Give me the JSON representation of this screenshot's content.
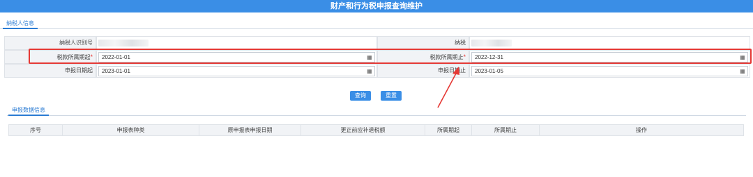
{
  "page_title": "财产和行为税申报查询维护",
  "tabs": {
    "taxpayer_info": "纳税人信息",
    "declaration_data": "申报数据信息"
  },
  "form": {
    "taxpayer_id_label": "纳税人识别号",
    "taxpayer_name_label": "纳税",
    "tax_period_start_label": "税款所属期起",
    "tax_period_start_value": "2022-01-01",
    "tax_period_end_label": "税款所属期止",
    "tax_period_end_value": "2022-12-31",
    "declare_date_start_label": "申报日期起",
    "declare_date_start_value": "2023-01-01",
    "declare_date_end_label": "申报日期止",
    "declare_date_end_value": "2023-01-05",
    "required_mark": "*",
    "calendar_icon_glyph": "▦"
  },
  "buttons": {
    "query": "查询",
    "reset": "重置"
  },
  "table": {
    "columns": [
      "序号",
      "申报表种类",
      "原申报表申报日期",
      "更正前应补退税额",
      "所属期起",
      "所属期止",
      "操作"
    ]
  },
  "colors": {
    "accent": "#3a8ee6",
    "highlight": "#e53935"
  }
}
